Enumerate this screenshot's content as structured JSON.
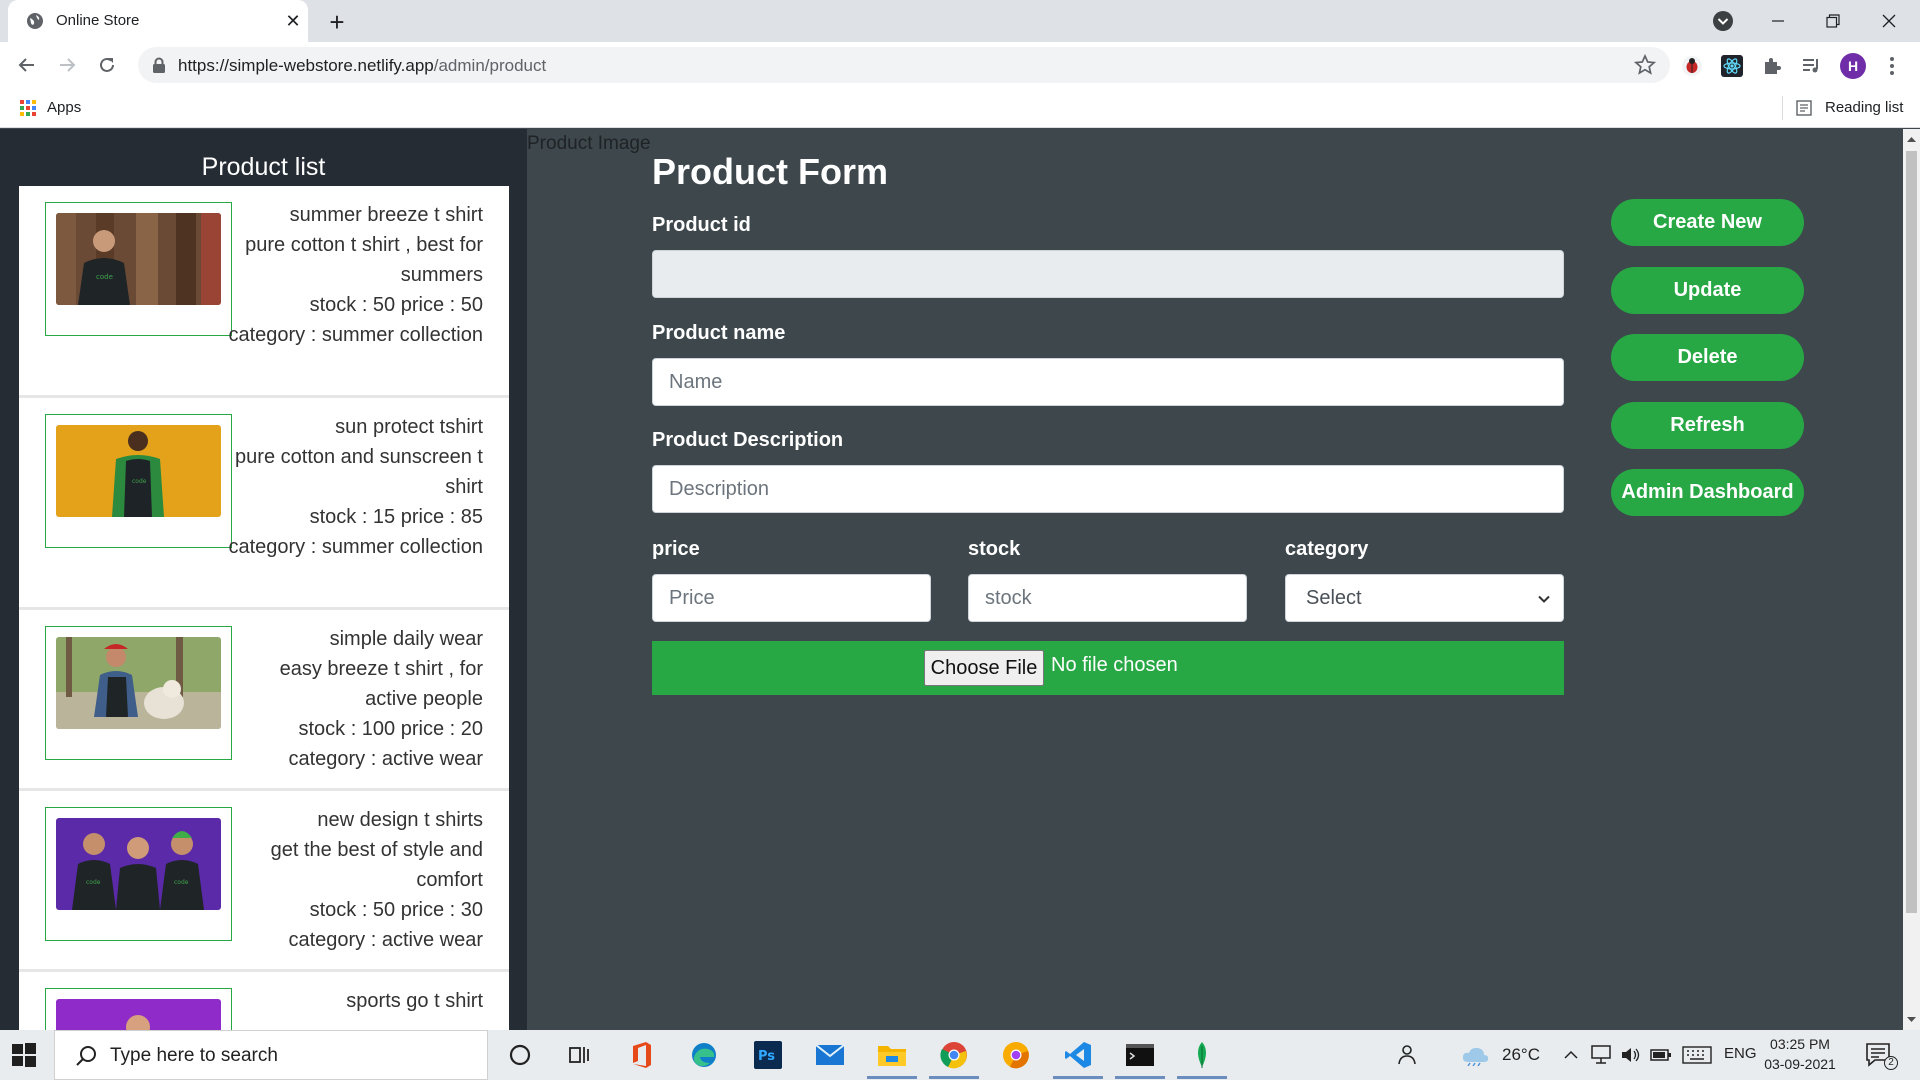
{
  "browser": {
    "tab_title": "Online Store",
    "url_host": "https://simple-webstore.netlify.app",
    "url_path": "/admin/product",
    "avatar_letter": "H",
    "bookmarks": {
      "apps_label": "Apps",
      "reading_list_label": "Reading list"
    }
  },
  "sidebar": {
    "title": "Product list",
    "products": [
      {
        "name": "summer breeze t shirt",
        "description": "pure cotton t shirt , best for summers",
        "stock_price": "stock : 50 price : 50",
        "category": "category : summer collection"
      },
      {
        "name": "sun protect tshirt",
        "description": "pure cotton and sunscreen t shirt",
        "stock_price": "stock : 15 price : 85",
        "category": "category : summer collection"
      },
      {
        "name": "simple daily wear",
        "description": "easy breeze t shirt , for active people",
        "stock_price": "stock : 100 price : 20",
        "category": "category : active wear"
      },
      {
        "name": "new design t shirts",
        "description": "get the best of style and comfort",
        "stock_price": "stock : 50 price : 30",
        "category": "category : active wear"
      },
      {
        "name": "sports go t shirt"
      }
    ]
  },
  "product_image_label": "Product Image",
  "form": {
    "title": "Product Form",
    "id_label": "Product id",
    "id_value": "",
    "name_label": "Product name",
    "name_placeholder": "Name",
    "description_label": "Product Description",
    "description_placeholder": "Description",
    "price_label": "price",
    "price_placeholder": "Price",
    "stock_label": "stock",
    "stock_placeholder": "stock",
    "category_label": "category",
    "category_selected": "Select",
    "file_button": "Choose File",
    "file_status": "No file chosen"
  },
  "actions": [
    "Create New",
    "Update",
    "Delete",
    "Refresh",
    "Admin Dashboard"
  ],
  "colors": {
    "accent": "#28a745",
    "page_bg": "#3d474c",
    "sidebar_bg": "#252c34"
  },
  "taskbar": {
    "search_placeholder": "Type here to search",
    "weather": "26°C",
    "language": "ENG",
    "time": "03:25 PM",
    "date": "03-09-2021",
    "notification_count": "2"
  }
}
